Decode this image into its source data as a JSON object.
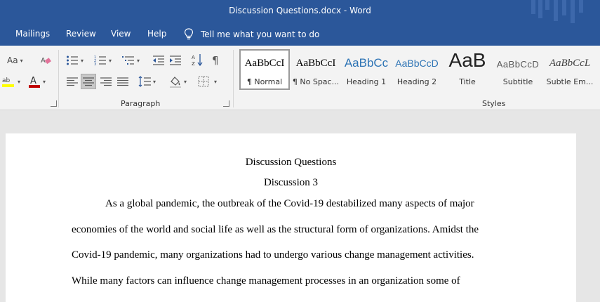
{
  "window": {
    "title": "Discussion Questions.docx  -  Word"
  },
  "menu": {
    "items": [
      "Mailings",
      "Review",
      "View",
      "Help"
    ],
    "tell_me": "Tell me what you want to do"
  },
  "ribbon": {
    "font_group": {
      "change_case": "Aa"
    },
    "paragraph_label": "Paragraph",
    "styles_label": "Styles",
    "styles": [
      {
        "sample": "AaBbCcI",
        "name": "¶ Normal"
      },
      {
        "sample": "AaBbCcI",
        "name": "¶ No Spac..."
      },
      {
        "sample": "AaBbCc",
        "name": "Heading 1"
      },
      {
        "sample": "AaBbCcD",
        "name": "Heading 2"
      },
      {
        "sample": "AaB",
        "name": "Title"
      },
      {
        "sample": "AaBbCcD",
        "name": "Subtitle"
      },
      {
        "sample": "AaBbCcL",
        "name": "Subtle Em..."
      }
    ],
    "colors": {
      "highlight": "#ffff00",
      "font_color": "#c00000",
      "accent": "#2b579a"
    }
  },
  "document": {
    "title": "Discussion Questions",
    "subtitle": "Discussion 3",
    "lines": [
      "As a global pandemic, the outbreak of the Covid-19 destabilized many aspects of major",
      "economies of the world and social life as well as the structural form of organizations. Amidst the",
      "Covid-19 pandemic, many organizations had to undergo various change management activities.",
      "While many factors can influence change management processes in an organization some of"
    ]
  }
}
